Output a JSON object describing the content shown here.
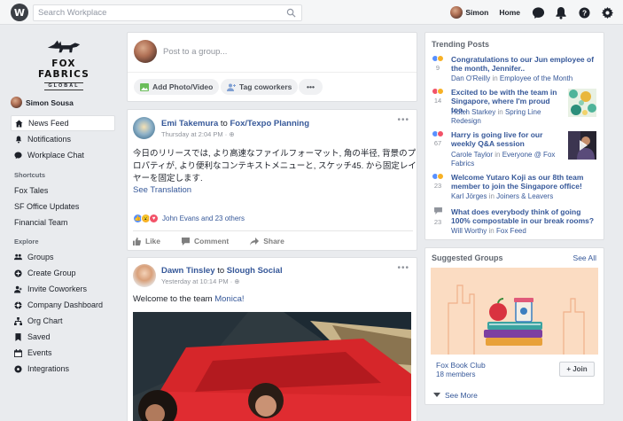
{
  "topbar": {
    "logo": "W",
    "search_placeholder": "Search Workplace",
    "user_name": "Simon",
    "home_label": "Home"
  },
  "sidebar": {
    "brand_name": "FOX FABRICS",
    "brand_sub": "GLOBAL",
    "user_name": "Simon Sousa",
    "main_items": [
      {
        "label": "News Feed",
        "icon": "home-icon"
      },
      {
        "label": "Notifications",
        "icon": "bell-icon"
      },
      {
        "label": "Workplace Chat",
        "icon": "chat-icon"
      }
    ],
    "shortcuts_heading": "Shortcuts",
    "shortcuts": [
      "Fox Tales",
      "SF Office Updates",
      "Financial Team"
    ],
    "explore_heading": "Explore",
    "explore": [
      {
        "label": "Groups",
        "icon": "groups-icon"
      },
      {
        "label": "Create Group",
        "icon": "plus-icon"
      },
      {
        "label": "Invite Coworkers",
        "icon": "invite-icon"
      },
      {
        "label": "Company Dashboard",
        "icon": "dashboard-icon"
      },
      {
        "label": "Org Chart",
        "icon": "org-chart-icon"
      },
      {
        "label": "Saved",
        "icon": "bookmark-icon"
      },
      {
        "label": "Events",
        "icon": "calendar-icon"
      },
      {
        "label": "Integrations",
        "icon": "integrations-icon"
      }
    ]
  },
  "composer": {
    "placeholder": "Post to a group...",
    "photo_label": "Add Photo/Video",
    "tag_label": "Tag coworkers",
    "more_label": "•••"
  },
  "post1": {
    "author": "Emi Takemura",
    "to": "to",
    "group": "Fox/Texpo Planning",
    "time": "Thursday at 2:04 PM",
    "dot": "·",
    "text_line1": "今日のリリースでは, より高速なファイルフォーマット, 角の半径, 背景のプ",
    "text_line2": "ロパティが, より便利なコンテキストメニューと, スケッチ45. から固定レイ",
    "text_line3": "ヤーを固定します.",
    "see_translation": "See Translation",
    "reactions": "John Evans and 23 others",
    "like": "Like",
    "comment": "Comment",
    "share": "Share"
  },
  "post2": {
    "author": "Dawn Tinsley",
    "to": "to",
    "group": "Slough Social",
    "time": "Yesterday at 10:14 PM",
    "dot": "·",
    "text": "Welcome to the team",
    "mention": "Monica!"
  },
  "trending": {
    "heading": "Trending Posts",
    "items": [
      {
        "title": "Congratulations to our Jun employee of the month, Jennifer..",
        "count": "9",
        "author": "Dan O'Reilly",
        "in": "in",
        "group": "Employee of the Month"
      },
      {
        "title": "Excited to be with the team in Singapore, where I'm proud too..",
        "count": "14",
        "author": "Hutch Starkey",
        "in": "in",
        "group": "Spring Line Redesign"
      },
      {
        "title": "Harry is going live for our weekly Q&A session",
        "count": "67",
        "author": "Carole Taylor",
        "in": "in",
        "group": "Everyone @ Fox Fabrics"
      },
      {
        "title": "Welcome Yutaro Koji as our 8th team member to join the Singapore office!",
        "count": "23",
        "author": "Karl Jörges",
        "in": "in",
        "group": "Joiners & Leavers"
      },
      {
        "title": "What does everybody think of going 100% compostable in our break rooms?",
        "count": "23",
        "author": "Will Worthy",
        "in": "in",
        "group": "Fox Feed"
      }
    ]
  },
  "suggested": {
    "heading": "Suggested Groups",
    "see_all": "See All",
    "group_name": "Fox Book Club",
    "members": "18 members",
    "join": "+ Join",
    "see_more": "See More"
  }
}
